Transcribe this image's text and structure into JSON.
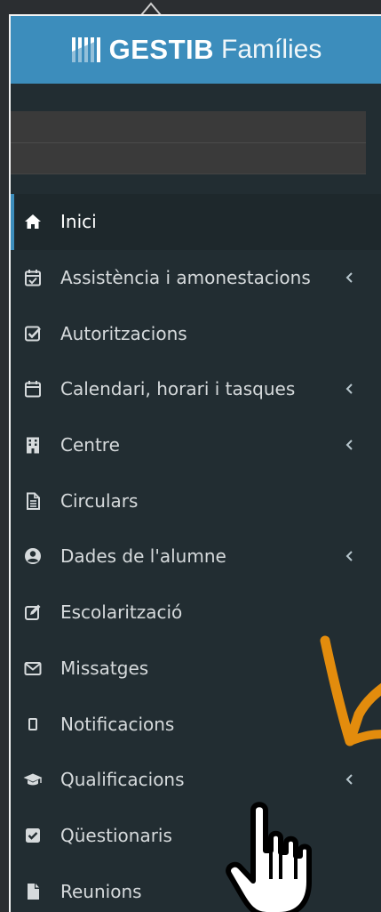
{
  "brand": {
    "strong": "GESTIB",
    "light": "Famílies",
    "logo_icon": "gestib-logo-icon"
  },
  "colors": {
    "brand_bar": "#3c8dbc",
    "sidebar_bg": "#222d32",
    "active_bg": "#1e282c",
    "text": "#d6dadc",
    "annotation_arrow": "#e38c0d"
  },
  "menu": {
    "items": [
      {
        "label": "Inici",
        "icon": "home-icon",
        "active": true,
        "has_submenu": false
      },
      {
        "label": "Assistència i amonestacions",
        "icon": "calendar-check-icon",
        "active": false,
        "has_submenu": true
      },
      {
        "label": "Autoritzacions",
        "icon": "check-square-icon",
        "active": false,
        "has_submenu": false
      },
      {
        "label": "Calendari, horari i tasques",
        "icon": "calendar-icon",
        "active": false,
        "has_submenu": true
      },
      {
        "label": "Centre",
        "icon": "building-icon",
        "active": false,
        "has_submenu": true
      },
      {
        "label": "Circulars",
        "icon": "file-text-icon",
        "active": false,
        "has_submenu": false
      },
      {
        "label": "Dades de l'alumne",
        "icon": "user-circle-icon",
        "active": false,
        "has_submenu": true
      },
      {
        "label": "Escolarització",
        "icon": "edit-icon",
        "active": false,
        "has_submenu": false
      },
      {
        "label": "Missatges",
        "icon": "envelope-icon",
        "active": false,
        "has_submenu": false
      },
      {
        "label": "Notificacions",
        "icon": "mobile-icon",
        "active": false,
        "has_submenu": false
      },
      {
        "label": "Qualificacions",
        "icon": "graduation-cap-icon",
        "active": false,
        "has_submenu": true
      },
      {
        "label": "Qüestionaris",
        "icon": "checkbox-checked-icon",
        "active": false,
        "has_submenu": false
      },
      {
        "label": "Reunions",
        "icon": "file-icon",
        "active": false,
        "has_submenu": false
      }
    ]
  }
}
